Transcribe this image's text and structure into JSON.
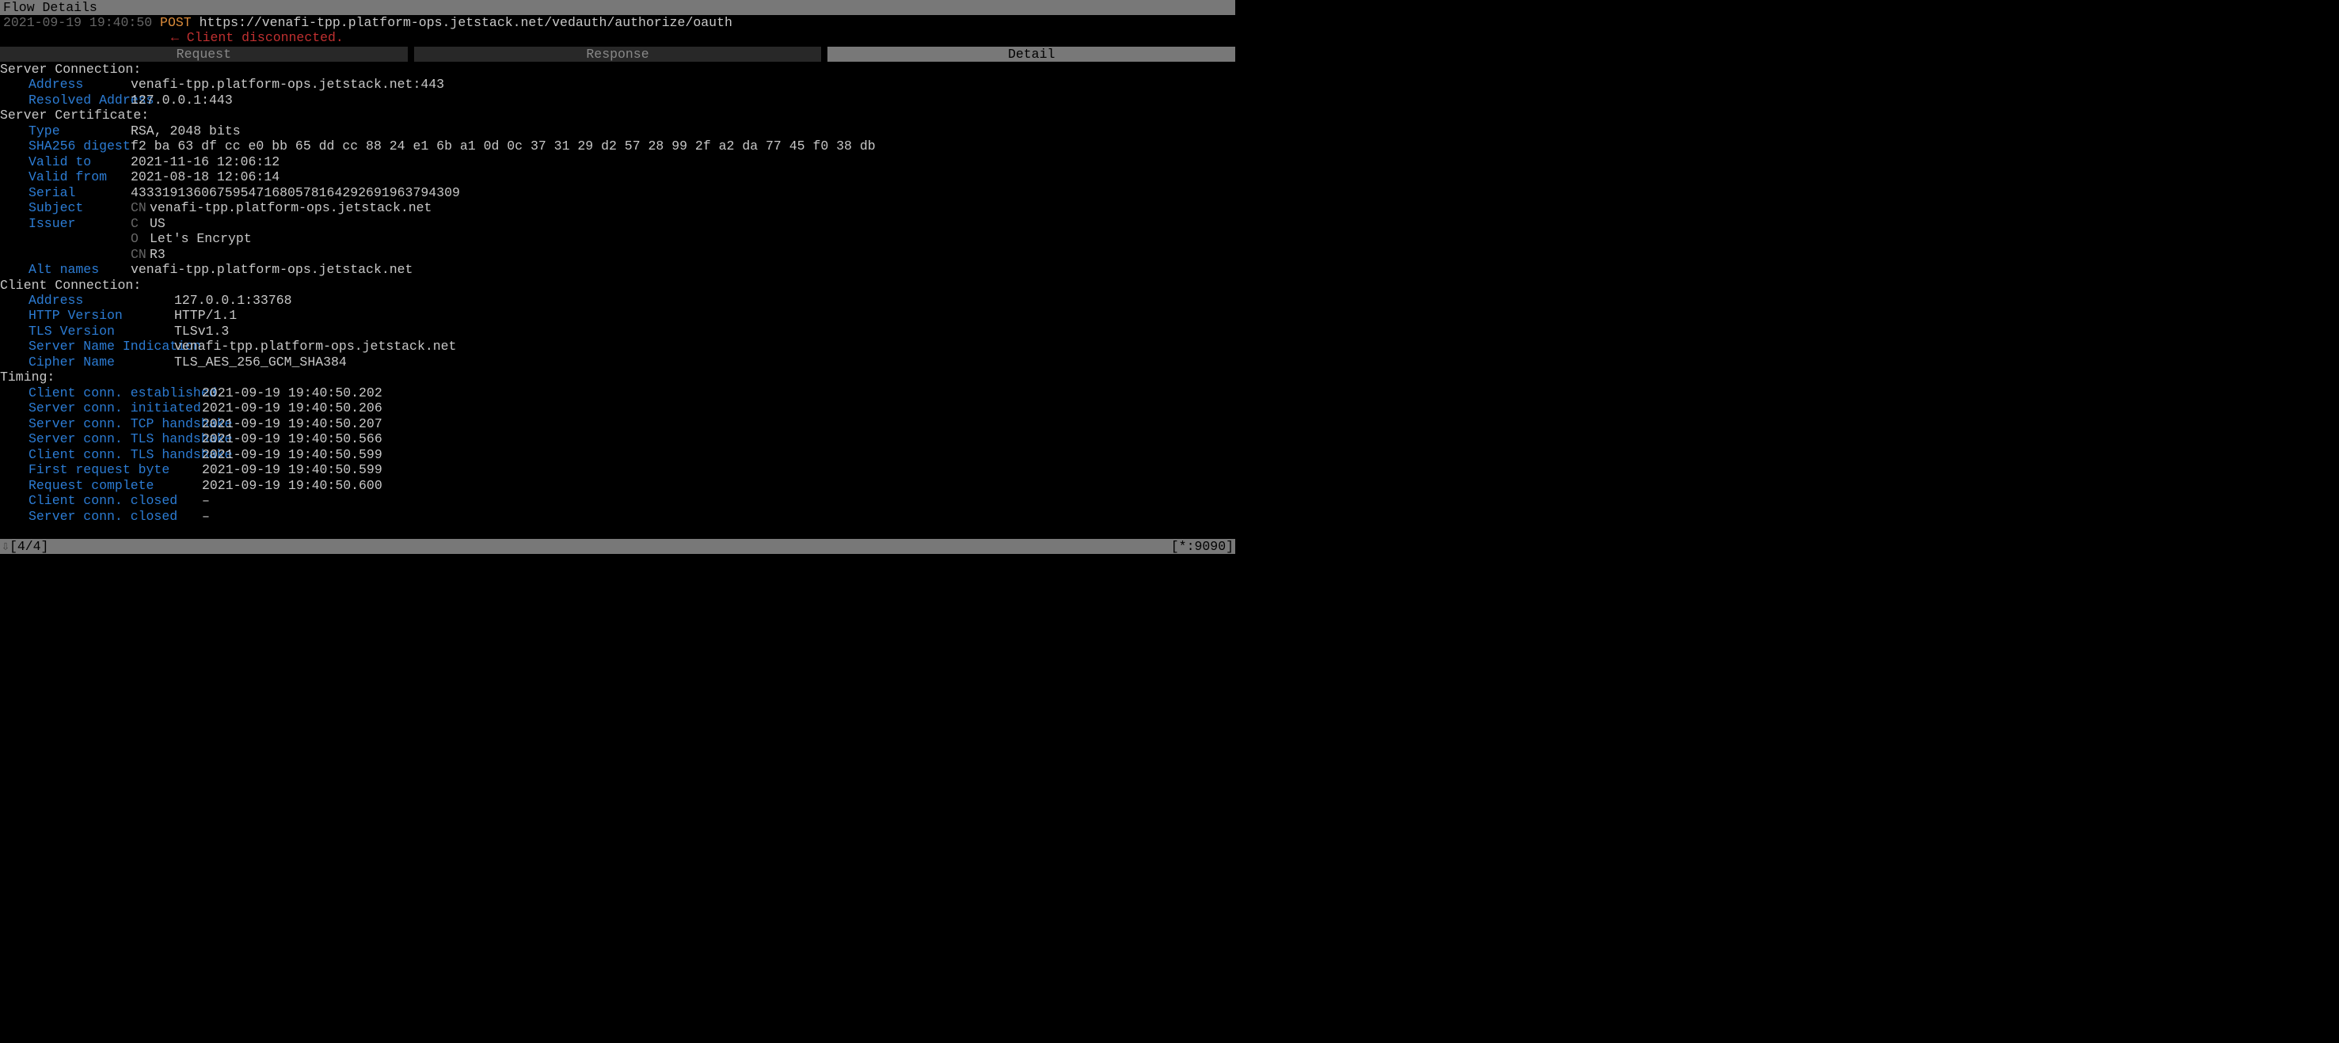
{
  "title": "Flow Details",
  "flow": {
    "timestamp": "2021-09-19 19:40:50",
    "method": "POST",
    "url": "https://venafi-tpp.platform-ops.jetstack.net/vedauth/authorize/oauth",
    "disconnect": "← Client disconnected."
  },
  "tabs": {
    "request": "Request",
    "response": "Response",
    "detail": "Detail"
  },
  "server_connection": {
    "header": "Server Connection:",
    "address_key": "Address",
    "address_val": "venafi-tpp.platform-ops.jetstack.net:443",
    "resolved_key": "Resolved Address",
    "resolved_val": "127.0.0.1:443"
  },
  "server_certificate": {
    "header": "Server Certificate:",
    "type_key": "Type",
    "type_val": "RSA, 2048 bits",
    "sha_key": "SHA256 digest",
    "sha_val": "f2 ba 63 df cc e0 bb 65 dd cc 88 24 e1 6b a1 0d 0c 37 31 29 d2 57 28 99 2f a2 da 77 45 f0 38 db",
    "validto_key": "Valid to",
    "validto_val": "2021-11-16 12:06:12",
    "validfrom_key": "Valid from",
    "validfrom_val": "2021-08-18 12:06:14",
    "serial_key": "Serial",
    "serial_val": "433319136067595471680578164292691963794309",
    "subject_key": "Subject",
    "subject_cn_k": "CN",
    "subject_cn_v": "venafi-tpp.platform-ops.jetstack.net",
    "issuer_key": "Issuer",
    "issuer_c_k": "C",
    "issuer_c_v": "US",
    "issuer_o_k": "O",
    "issuer_o_v": "Let's Encrypt",
    "issuer_cn_k": "CN",
    "issuer_cn_v": "R3",
    "altnames_key": "Alt names",
    "altnames_val": "venafi-tpp.platform-ops.jetstack.net"
  },
  "client_connection": {
    "header": "Client Connection:",
    "address_key": "Address",
    "address_val": "127.0.0.1:33768",
    "httpver_key": "HTTP Version",
    "httpver_val": "HTTP/1.1",
    "tlsver_key": "TLS Version",
    "tlsver_val": "TLSv1.3",
    "sni_key": "Server Name Indication",
    "sni_val": "venafi-tpp.platform-ops.jetstack.net",
    "cipher_key": "Cipher Name",
    "cipher_val": "TLS_AES_256_GCM_SHA384"
  },
  "timing": {
    "header": "Timing:",
    "cce_key": "Client conn. established",
    "cce_val": "2021-09-19 19:40:50.202",
    "sci_key": "Server conn. initiated",
    "sci_val": "2021-09-19 19:40:50.206",
    "sctcp_key": "Server conn. TCP handshake",
    "sctcp_val": "2021-09-19 19:40:50.207",
    "sctls_key": "Server conn. TLS handshake",
    "sctls_val": "2021-09-19 19:40:50.566",
    "cctls_key": "Client conn. TLS handshake",
    "cctls_val": "2021-09-19 19:40:50.599",
    "frb_key": "First request byte",
    "frb_val": "2021-09-19 19:40:50.599",
    "rc_key": "Request complete",
    "rc_val": "2021-09-19 19:40:50.600",
    "ccc_key": "Client conn. closed",
    "ccc_val": "–",
    "scc_key": "Server conn. closed",
    "scc_val": "–"
  },
  "status": {
    "arrow": "⇩",
    "position": "[4/4]",
    "bind": "[*:9090]"
  }
}
